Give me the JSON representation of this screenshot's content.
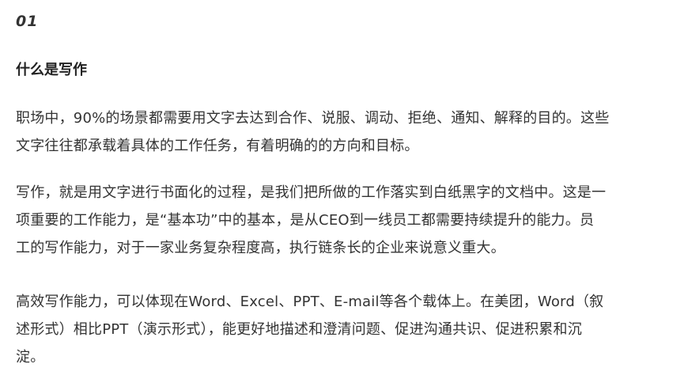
{
  "section": {
    "number": "01",
    "heading": "什么是写作"
  },
  "paragraphs": [
    {
      "lines": [
        "职场中，90%的场景都需要用文字去达到合作、说服、调动、拒绝、通知、解释的目的。这些",
        "文字往往都承载着具体的工作任务，有着明确的的方向和目标。"
      ]
    },
    {
      "lines": [
        "写作，就是用文字进行书面化的过程，是我们把所做的工作落实到白纸黑字的文档中。这是一",
        "项重要的工作能力，是“基本功”中的基本，是从CEO到一线员工都需要持续提升的能力。员",
        "工的写作能力，对于一家业务复杂程度高，执行链条长的企业来说意义重大。"
      ]
    },
    {
      "lines": [
        "高效写作能力，可以体现在Word、Excel、PPT、E-mail等各个载体上。在美团，Word（叙",
        "述形式）相比PPT（演示形式），能更好地描述和澄清问题、促进沟通共识、促进积累和沉",
        "淀。"
      ]
    }
  ]
}
